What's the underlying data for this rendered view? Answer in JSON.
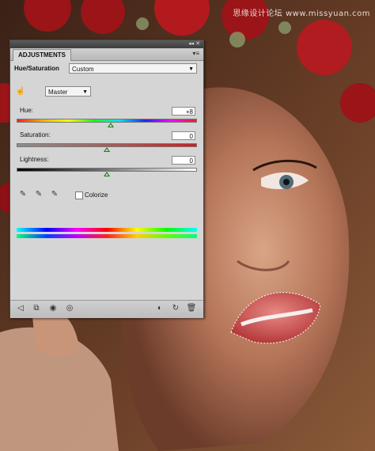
{
  "watermark": "思缘设计论坛 www.missyuan.com",
  "panel": {
    "tab_label": "ADJUSTMENTS",
    "menu_icon": "panel-menu-icon",
    "title": "Hue/Saturation",
    "preset": "Custom",
    "channel": "Master",
    "colorize_label": "Colorize",
    "colorize_checked": false,
    "sliders": [
      {
        "label": "Hue:",
        "value": "+8",
        "position": 0.52
      },
      {
        "label": "Saturation:",
        "value": "0",
        "position": 0.5
      },
      {
        "label": "Lightness:",
        "value": "0",
        "position": 0.5
      }
    ],
    "icons": {
      "targeted_adjust": "hand-adjust-icon",
      "eyedroppers": [
        "eyedropper-icon",
        "eyedropper-plus-icon",
        "eyedropper-minus-icon"
      ],
      "bottom_left": [
        "back-arrow-icon",
        "expand-view-icon",
        "clip-layer-icon",
        "visibility-eye-icon"
      ],
      "bottom_right": [
        "previous-state-icon",
        "reset-icon",
        "delete-icon"
      ]
    },
    "colors": {
      "panel_bg": "#d5d5d5",
      "thumb": "#1a7a1a",
      "saturation_bar_end": "#cc1f1f"
    }
  }
}
